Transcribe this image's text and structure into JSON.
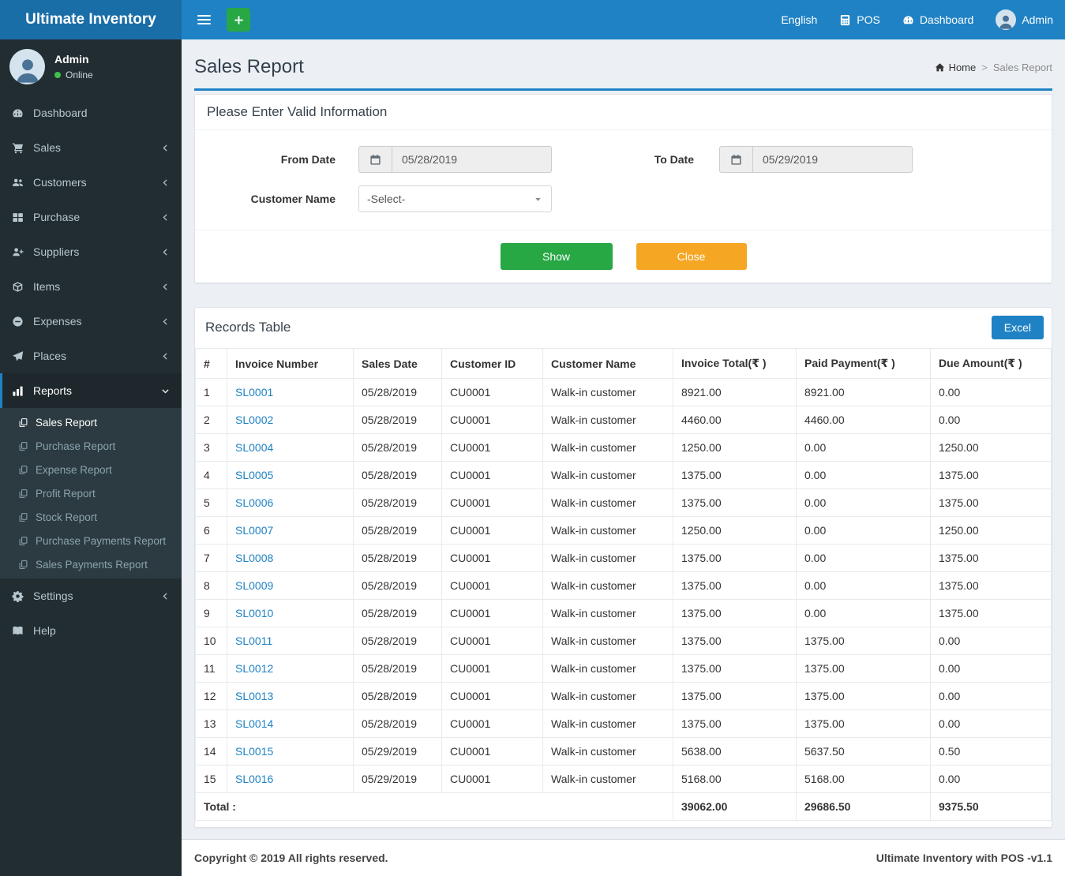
{
  "topbar": {
    "brand": "Ultimate Inventory",
    "language": "English",
    "pos_label": "POS",
    "pos_icon": "calculator-icon",
    "dashboard_label": "Dashboard",
    "dashboard_icon": "gauge-icon",
    "user_label": "Admin"
  },
  "sidebar": {
    "user_name": "Admin",
    "user_status": "Online",
    "menu": [
      {
        "label": "Dashboard",
        "icon": "gauge-icon"
      },
      {
        "label": "Sales",
        "icon": "cart-icon"
      },
      {
        "label": "Customers",
        "icon": "users-icon"
      },
      {
        "label": "Purchase",
        "icon": "grid-icon"
      },
      {
        "label": "Suppliers",
        "icon": "user-plus-icon"
      },
      {
        "label": "Items",
        "icon": "cube-icon"
      },
      {
        "label": "Expenses",
        "icon": "minus-circle-icon"
      },
      {
        "label": "Places",
        "icon": "paper-plane-icon"
      },
      {
        "label": "Reports",
        "icon": "bar-chart-icon"
      },
      {
        "label": "Settings",
        "icon": "gear-icon"
      },
      {
        "label": "Help",
        "icon": "book-icon"
      }
    ],
    "reports_submenu": [
      {
        "label": "Sales Report",
        "icon": "copy-icon"
      },
      {
        "label": "Purchase Report",
        "icon": "copy-icon"
      },
      {
        "label": "Expense Report",
        "icon": "copy-icon"
      },
      {
        "label": "Profit Report",
        "icon": "copy-icon"
      },
      {
        "label": "Stock Report",
        "icon": "copy-icon"
      },
      {
        "label": "Purchase Payments Report",
        "icon": "copy-icon"
      },
      {
        "label": "Sales Payments Report",
        "icon": "copy-icon"
      }
    ]
  },
  "page": {
    "title": "Sales Report",
    "breadcrumb_home": "Home",
    "breadcrumb_separator": ">",
    "breadcrumb_current": "Sales Report"
  },
  "filter_panel": {
    "title": "Please Enter Valid Information",
    "from_date_label": "From Date",
    "from_date_value": "05/28/2019",
    "to_date_label": "To Date",
    "to_date_value": "05/29/2019",
    "date_icon": "calendar-icon",
    "customer_label": "Customer Name",
    "customer_value": "-Select-",
    "show_button": "Show",
    "close_button": "Close"
  },
  "records": {
    "title": "Records Table",
    "excel_button": "Excel",
    "columns": [
      "#",
      "Invoice Number",
      "Sales Date",
      "Customer ID",
      "Customer Name",
      "Invoice Total(₹ )",
      "Paid Payment(₹ )",
      "Due Amount(₹ )"
    ],
    "rows": [
      {
        "sn": "1",
        "invoice": "SL0001",
        "date": "05/28/2019",
        "customer_id": "CU0001",
        "customer_name": "Walk-in customer",
        "total": "8921.00",
        "paid": "8921.00",
        "due": "0.00"
      },
      {
        "sn": "2",
        "invoice": "SL0002",
        "date": "05/28/2019",
        "customer_id": "CU0001",
        "customer_name": "Walk-in customer",
        "total": "4460.00",
        "paid": "4460.00",
        "due": "0.00"
      },
      {
        "sn": "3",
        "invoice": "SL0004",
        "date": "05/28/2019",
        "customer_id": "CU0001",
        "customer_name": "Walk-in customer",
        "total": "1250.00",
        "paid": "0.00",
        "due": "1250.00"
      },
      {
        "sn": "4",
        "invoice": "SL0005",
        "date": "05/28/2019",
        "customer_id": "CU0001",
        "customer_name": "Walk-in customer",
        "total": "1375.00",
        "paid": "0.00",
        "due": "1375.00"
      },
      {
        "sn": "5",
        "invoice": "SL0006",
        "date": "05/28/2019",
        "customer_id": "CU0001",
        "customer_name": "Walk-in customer",
        "total": "1375.00",
        "paid": "0.00",
        "due": "1375.00"
      },
      {
        "sn": "6",
        "invoice": "SL0007",
        "date": "05/28/2019",
        "customer_id": "CU0001",
        "customer_name": "Walk-in customer",
        "total": "1250.00",
        "paid": "0.00",
        "due": "1250.00"
      },
      {
        "sn": "7",
        "invoice": "SL0008",
        "date": "05/28/2019",
        "customer_id": "CU0001",
        "customer_name": "Walk-in customer",
        "total": "1375.00",
        "paid": "0.00",
        "due": "1375.00"
      },
      {
        "sn": "8",
        "invoice": "SL0009",
        "date": "05/28/2019",
        "customer_id": "CU0001",
        "customer_name": "Walk-in customer",
        "total": "1375.00",
        "paid": "0.00",
        "due": "1375.00"
      },
      {
        "sn": "9",
        "invoice": "SL0010",
        "date": "05/28/2019",
        "customer_id": "CU0001",
        "customer_name": "Walk-in customer",
        "total": "1375.00",
        "paid": "0.00",
        "due": "1375.00"
      },
      {
        "sn": "10",
        "invoice": "SL0011",
        "date": "05/28/2019",
        "customer_id": "CU0001",
        "customer_name": "Walk-in customer",
        "total": "1375.00",
        "paid": "1375.00",
        "due": "0.00"
      },
      {
        "sn": "11",
        "invoice": "SL0012",
        "date": "05/28/2019",
        "customer_id": "CU0001",
        "customer_name": "Walk-in customer",
        "total": "1375.00",
        "paid": "1375.00",
        "due": "0.00"
      },
      {
        "sn": "12",
        "invoice": "SL0013",
        "date": "05/28/2019",
        "customer_id": "CU0001",
        "customer_name": "Walk-in customer",
        "total": "1375.00",
        "paid": "1375.00",
        "due": "0.00"
      },
      {
        "sn": "13",
        "invoice": "SL0014",
        "date": "05/28/2019",
        "customer_id": "CU0001",
        "customer_name": "Walk-in customer",
        "total": "1375.00",
        "paid": "1375.00",
        "due": "0.00"
      },
      {
        "sn": "14",
        "invoice": "SL0015",
        "date": "05/29/2019",
        "customer_id": "CU0001",
        "customer_name": "Walk-in customer",
        "total": "5638.00",
        "paid": "5637.50",
        "due": "0.50"
      },
      {
        "sn": "15",
        "invoice": "SL0016",
        "date": "05/29/2019",
        "customer_id": "CU0001",
        "customer_name": "Walk-in customer",
        "total": "5168.00",
        "paid": "5168.00",
        "due": "0.00"
      }
    ],
    "total_label": "Total :",
    "totals": {
      "invoice_total": "39062.00",
      "paid_payment": "29686.50",
      "due_amount": "9375.50"
    }
  },
  "footer": {
    "copyright": "Copyright © 2019 All rights reserved.",
    "version": "Ultimate Inventory with POS -v1.1"
  },
  "colors": {
    "navbar_blue": "#1f82c4",
    "logo_blue": "#1a6ea8",
    "sidebar_dark": "#222d32",
    "submenu_dark": "#2c3b41",
    "accent_blue": "#1f82c4",
    "success_green": "#28a745",
    "warning_orange": "#f5a623",
    "online_green": "#3fbf4d"
  }
}
